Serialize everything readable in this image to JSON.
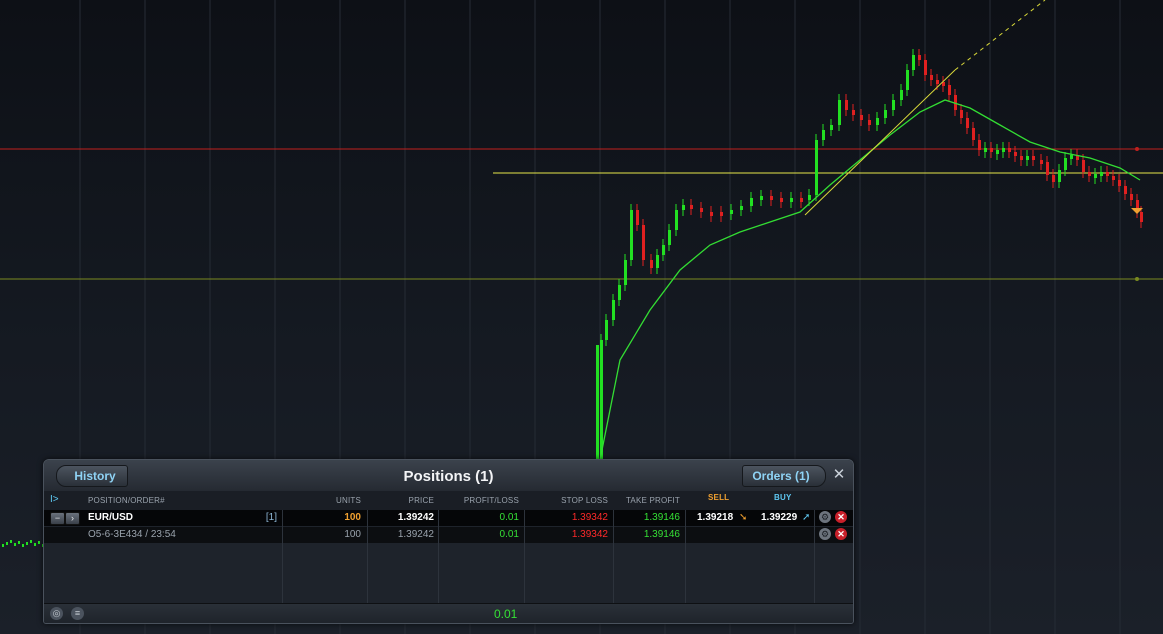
{
  "chart_colors": {
    "up": "#22e022",
    "down": "#e02020",
    "ma": "#33dd33",
    "resistance": "#e8e84a",
    "upper_level": "#c0201e",
    "lower_level": "#7a8a20",
    "trendline": "#d8d83a"
  },
  "panel": {
    "title": "Positions (1)",
    "history_label": "History",
    "orders_label": "Orders (1)",
    "close_icon": "close-icon",
    "columns": {
      "position": "POSITION/ORDER#",
      "units": "UNITS",
      "price": "PRICE",
      "pl": "PROFIT/LOSS",
      "stop_loss": "STOP LOSS",
      "take_profit": "TAKE PROFIT",
      "sell": "SELL",
      "buy": "BUY"
    },
    "position": {
      "symbol": "EUR/USD",
      "count": "[1]",
      "units": "100",
      "price": "1.39242",
      "pl": "0.01",
      "stop_loss": "1.39342",
      "take_profit": "1.39146",
      "sell": "1.39218",
      "buy": "1.39229"
    },
    "order": {
      "id": "O5-6-3E434 / 23:54",
      "units": "100",
      "price": "1.39242",
      "pl": "0.01",
      "stop_loss": "1.39342",
      "take_profit": "1.39146"
    },
    "total_pl": "0.01"
  }
}
